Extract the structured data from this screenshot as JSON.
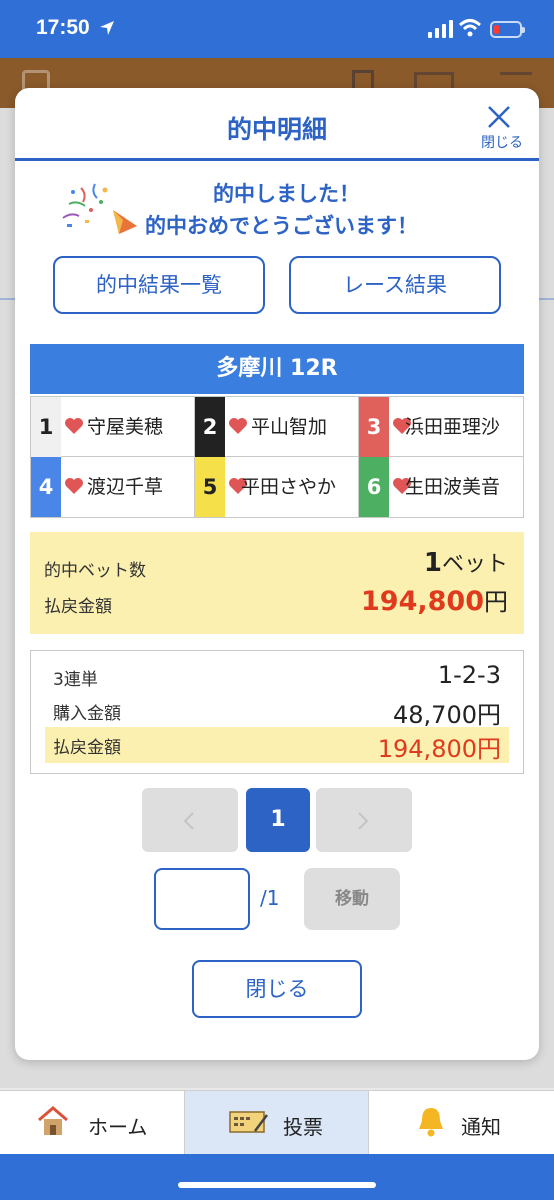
{
  "status_bar": {
    "time": "17:50"
  },
  "modal": {
    "title": "的中明細",
    "close_label": "閉じる",
    "congrats_line1": "的中しました！",
    "congrats_line2": "的中おめでとうございます！",
    "buttons": {
      "hit_list": "的中結果一覧",
      "race_result": "レース結果"
    },
    "race_title": "多摩川 12R",
    "racers": [
      {
        "num": "1",
        "name": "守屋美穂",
        "color": "#f0f0f0",
        "num_color": "#222222"
      },
      {
        "num": "2",
        "name": "平山智加",
        "color": "#222222",
        "num_color": "#ffffff"
      },
      {
        "num": "3",
        "name": "浜田亜理沙",
        "color": "#e0615c",
        "num_color": "#ffffff"
      },
      {
        "num": "4",
        "name": "渡辺千草",
        "color": "#4a86e8",
        "num_color": "#ffffff"
      },
      {
        "num": "5",
        "name": "平田さやか",
        "color": "#f5e04a",
        "num_color": "#222222"
      },
      {
        "num": "6",
        "name": "生田波美音",
        "color": "#4caf62",
        "num_color": "#ffffff"
      }
    ],
    "summary": {
      "bet_count_label": "的中ベット数",
      "bet_count_value": "1",
      "bet_count_unit": "ベット",
      "payout_label": "払戻金額",
      "payout_value": "194,800",
      "payout_unit": "円"
    },
    "detail": {
      "bet_type": "3連単",
      "combination": "1-2-3",
      "purchase_label": "購入金額",
      "purchase_value": "48,700円",
      "payout_label": "払戻金額",
      "payout_value": "194,800円"
    },
    "pagination": {
      "current": "1",
      "total": "/1",
      "input_value": "",
      "move_label": "移動"
    },
    "close_button": "閉じる"
  },
  "tabbar": {
    "home": "ホーム",
    "vote": "投票",
    "notify": "通知"
  },
  "colors": {
    "primary": "#2c63c4",
    "accent_red": "#e03a1e",
    "highlight": "#fbf0b0",
    "status_bar": "#2f6fd6"
  }
}
